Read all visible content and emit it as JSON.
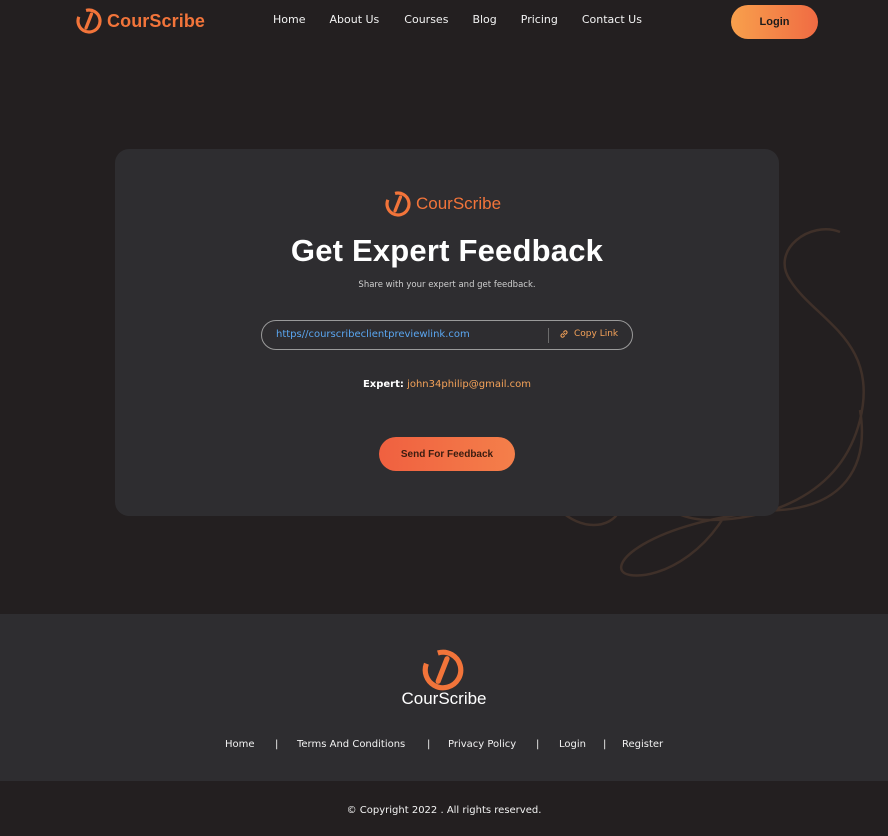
{
  "nav": {
    "brand": "CourScribe",
    "links": [
      "Home",
      "About Us",
      "Courses",
      "Blog",
      "Pricing",
      "Contact Us"
    ],
    "login_label": "Login"
  },
  "card": {
    "brand": "CourScribe",
    "title": "Get Expert Feedback",
    "subtitle": "Share with your expert and get feedback.",
    "link_url": "https//courscribeclientpreviewlink.com",
    "copy_link_label": "Copy Link",
    "expert_label": "Expert:",
    "expert_email": "john34philip@gmail.com",
    "send_label": "Send For Feedback"
  },
  "footer": {
    "brand": "CourScribe",
    "links": [
      "Home",
      "Terms And Conditions",
      "Privacy Policy",
      "Login",
      "Register"
    ],
    "separator": "|",
    "copyright": "© Copyright 2022 . All rights reserved."
  },
  "colors": {
    "background": "#231f20",
    "card": "#2e2d30",
    "accent": "#f2743a",
    "link": "#5aa6f0",
    "email": "#f4a259"
  },
  "icons": {
    "brand_logo": "courscribe-logo-icon",
    "copy": "link-icon"
  }
}
